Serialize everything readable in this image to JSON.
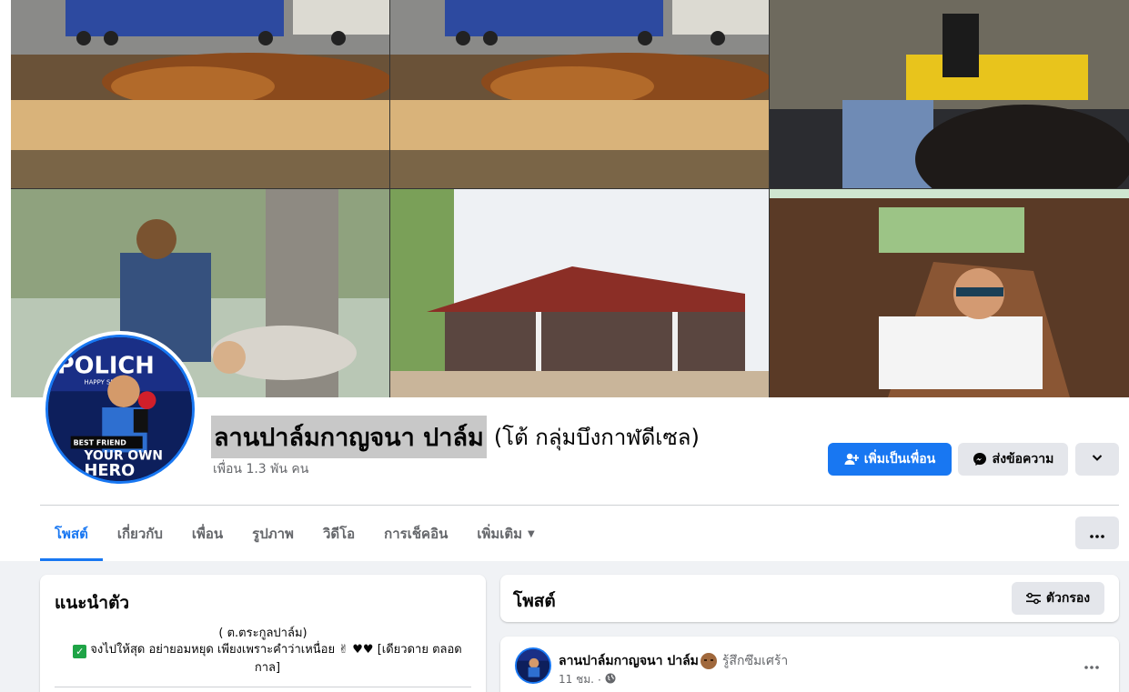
{
  "profile": {
    "name": "ลานปาล์มกาญจนา ปาล์ม",
    "alternate_name": "(โต้ กลุ่มบึงกาฬดีเซล)",
    "friends_count": "เพื่อน 1.3 พัน คน",
    "avatar_text_top": "POLICH",
    "avatar_text_sub": "HAPPY SPRIN",
    "avatar_text_best": "BEST FRIEND",
    "avatar_text_own": "YOUR OWN",
    "avatar_text_hero": "HERO"
  },
  "actions": {
    "add_friend": "เพิ่มเป็นเพื่อน",
    "message": "ส่งข้อความ",
    "add_friend_icon": "add-person-icon",
    "message_icon": "messenger-icon",
    "more_icon": "chevron-down-icon"
  },
  "tabs": [
    {
      "label": "โพสต์",
      "active": true
    },
    {
      "label": "เกี่ยวกับ"
    },
    {
      "label": "เพื่อน"
    },
    {
      "label": "รูปภาพ"
    },
    {
      "label": "วิดีโอ"
    },
    {
      "label": "การเช็คอิน"
    },
    {
      "label": "เพิ่มเติม"
    }
  ],
  "intro": {
    "title": "แนะนำตัว",
    "line1": "( ต.ตระกูลปาล์ม)",
    "bio": "จงไปให้สุด อย่ายอมหยุด เพียงเพราะคำว่าเหนื่อย ✌ ♥♥ [เดียวดาย ตลอดกาล]"
  },
  "posts_header": {
    "title": "โพสต์",
    "filter_label": "ตัวกรอง",
    "filter_icon": "sliders-icon"
  },
  "post": {
    "author": "ลานปาล์มกาญจนา ปาล์ม",
    "feeling": "รู้สึกซึมเศร้า",
    "time": "11 ชม.",
    "separator": "·",
    "privacy_icon": "globe-icon"
  },
  "colors": {
    "accent": "#1877f2",
    "background": "#f0f2f5",
    "secondary_button": "#e4e6eb",
    "muted_text": "#65676b"
  }
}
